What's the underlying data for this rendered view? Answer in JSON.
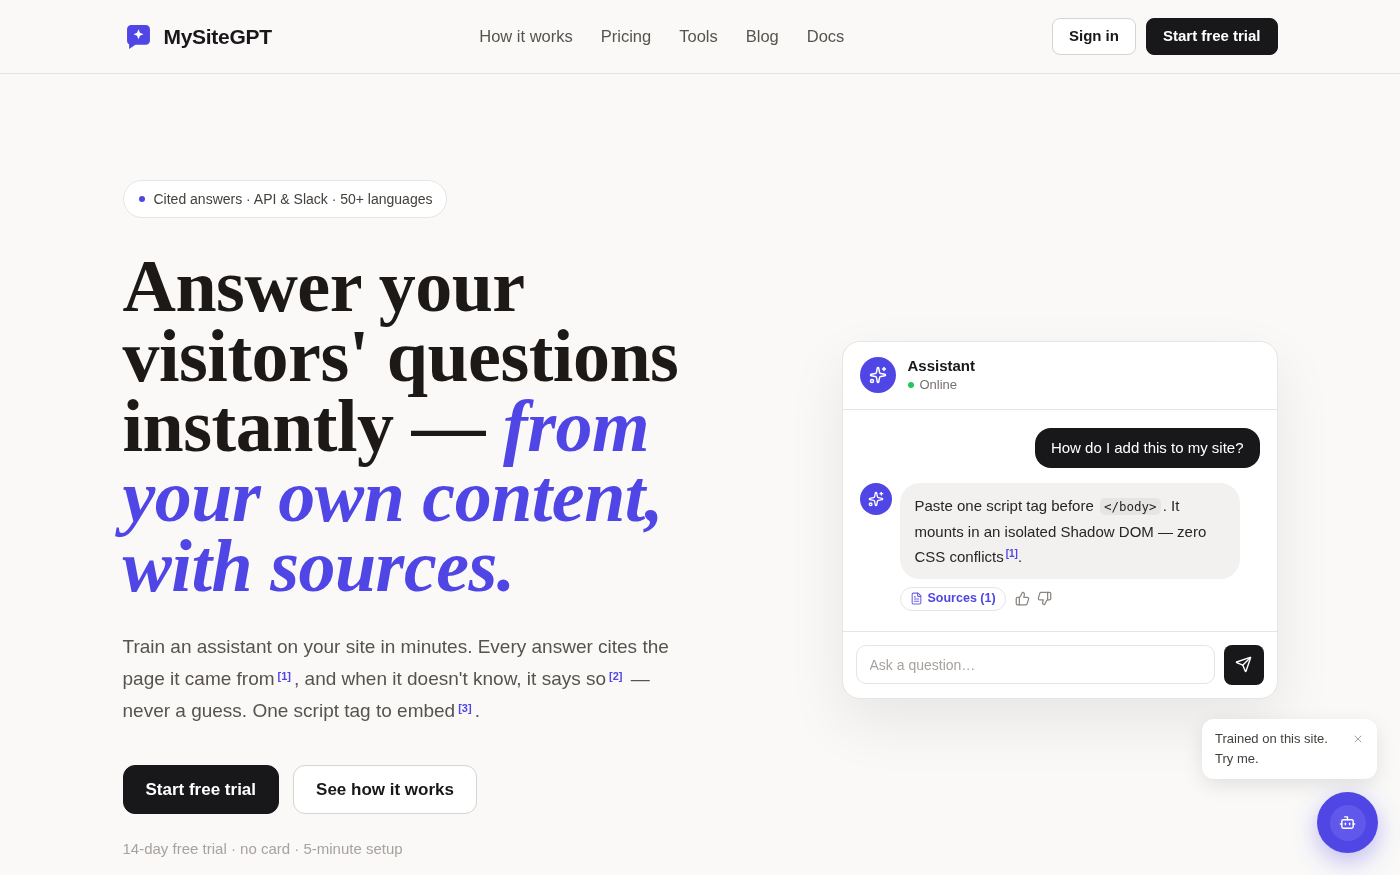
{
  "header": {
    "brand": "MySiteGPT",
    "nav": [
      {
        "label": "How it works"
      },
      {
        "label": "Pricing"
      },
      {
        "label": "Tools"
      },
      {
        "label": "Blog"
      },
      {
        "label": "Docs"
      }
    ],
    "actions": [
      {
        "label": "Sign in",
        "kind": "secondary"
      },
      {
        "label": "Start free trial",
        "kind": "primary"
      }
    ]
  },
  "hero": {
    "badge": "Cited answers · API & Slack · 50+ languages",
    "headline": "Answer your visitors' questions instantly — *from your own content, with sources.*",
    "description": "Train an assistant on your site in minutes. Every answer cites the page it came from$^{[1]}$, and when it doesn't know, it says so$^{[2]}$ — never a guess. One script tag to embed$^{[3]}$.",
    "buttons": [
      {
        "label": "Start free trial",
        "kind": "primary"
      },
      {
        "label": "See how it works",
        "kind": "secondary"
      }
    ],
    "note": "14-day free trial · no card · 5-minute setup"
  },
  "chat": {
    "title": "Assistant",
    "status": "Online",
    "online": true,
    "messages": [
      {
        "kind": "user",
        "parts": [
          {
            "kind": "text",
            "text": "How do I add this to my site?"
          }
        ]
      },
      {
        "kind": "assistant",
        "parts": [
          {
            "kind": "text",
            "text": "Paste one script tag before "
          },
          {
            "kind": "code",
            "text": "</body>"
          },
          {
            "kind": "text",
            "text": ". It mounts in an isolated Shadow DOM — zero CSS conflicts$^{[1]}$."
          }
        ],
        "sources": "Sources (1)"
      }
    ],
    "input": {
      "placeholder": "Ask a question…"
    }
  },
  "launcher": {
    "tooltip": "Trained on this site. Try me."
  }
}
